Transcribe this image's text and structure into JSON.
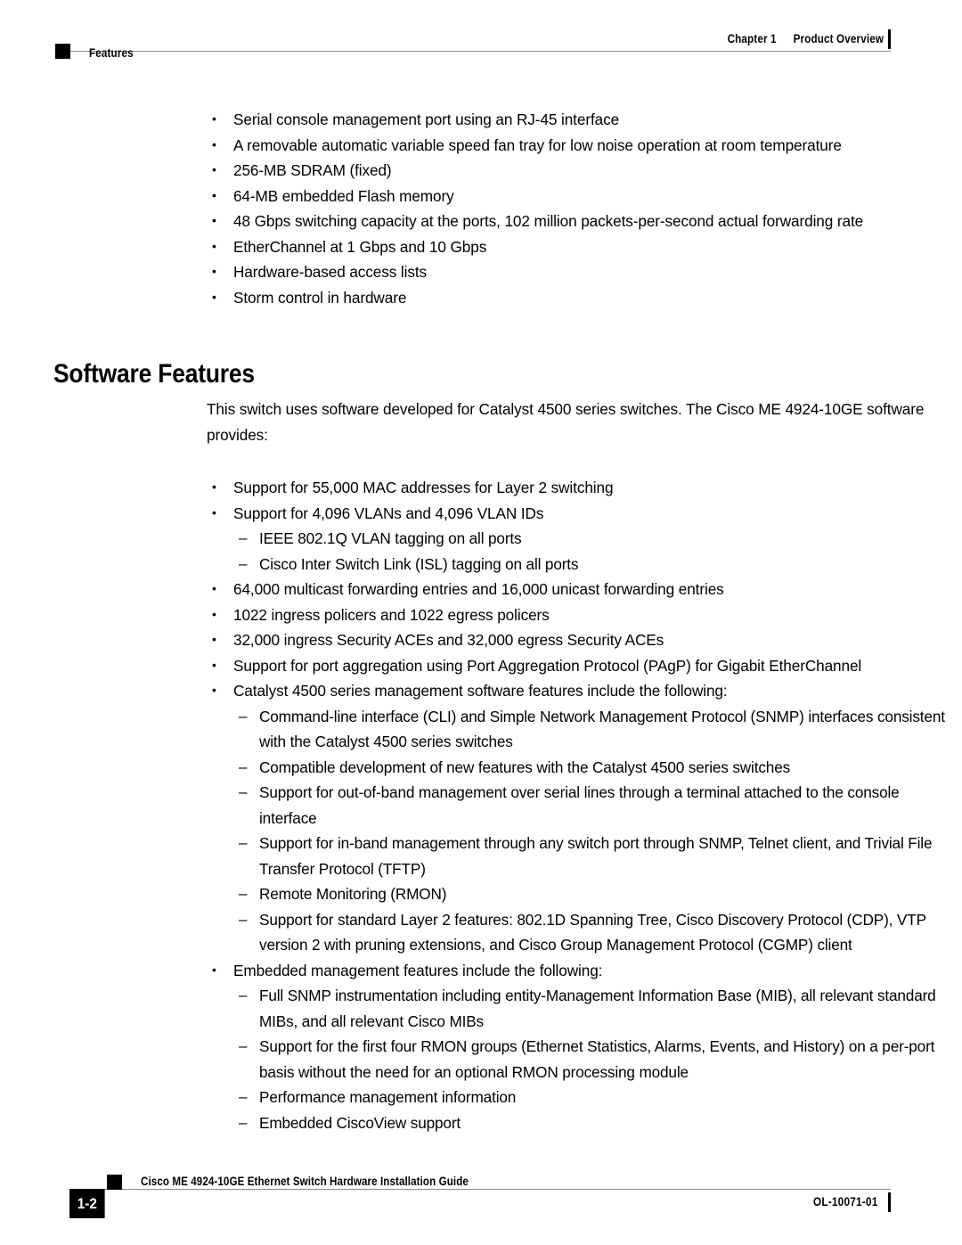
{
  "header": {
    "chapter": "Chapter 1",
    "chapter_title": "Product Overview",
    "section": "Features"
  },
  "hardware_bullets": [
    "Serial console management port using an RJ-45 interface",
    "A removable automatic variable speed fan tray for low noise operation at room temperature",
    "256-MB SDRAM (fixed)",
    "64-MB embedded Flash memory",
    "48 Gbps switching capacity at the ports, 102 million packets-per-second actual forwarding rate",
    "EtherChannel at 1 Gbps and 10 Gbps",
    "Hardware-based access lists",
    "Storm control in hardware"
  ],
  "software_section": {
    "heading": "Software Features",
    "intro": "This switch uses software developed for Catalyst 4500 series switches. The Cisco ME 4924-10GE software provides:",
    "items": [
      {
        "level": 1,
        "text": "Support for 55,000 MAC addresses for Layer 2 switching"
      },
      {
        "level": 1,
        "text": "Support for 4,096 VLANs and 4,096 VLAN IDs"
      },
      {
        "level": 2,
        "text": "IEEE 802.1Q VLAN tagging on all ports"
      },
      {
        "level": 2,
        "text": "Cisco Inter Switch Link (ISL) tagging on all ports"
      },
      {
        "level": 1,
        "text": "64,000 multicast forwarding entries and 16,000 unicast forwarding entries"
      },
      {
        "level": 1,
        "text": "1022 ingress policers and 1022 egress policers"
      },
      {
        "level": 1,
        "text": "32,000 ingress Security ACEs and 32,000 egress Security ACEs"
      },
      {
        "level": 1,
        "text": "Support for port aggregation using Port Aggregation Protocol (PAgP) for Gigabit EtherChannel"
      },
      {
        "level": 1,
        "text": "Catalyst 4500 series management software features include the following:"
      },
      {
        "level": 2,
        "text": "Command-line interface (CLI) and Simple Network Management Protocol (SNMP) interfaces consistent with the Catalyst 4500 series switches"
      },
      {
        "level": 2,
        "text": "Compatible development of new features with the Catalyst 4500 series switches"
      },
      {
        "level": 2,
        "text": "Support for out-of-band management over serial lines through a terminal attached to the console interface"
      },
      {
        "level": 2,
        "text": "Support for in-band management through any switch port through SNMP, Telnet client, and Trivial File Transfer Protocol (TFTP)"
      },
      {
        "level": 2,
        "text": "Remote Monitoring (RMON)"
      },
      {
        "level": 2,
        "text": "Support for standard Layer 2 features: 802.1D Spanning Tree, Cisco Discovery Protocol (CDP), VTP version 2 with pruning extensions, and Cisco Group Management Protocol (CGMP) client"
      },
      {
        "level": 1,
        "text": "Embedded management features include the following:"
      },
      {
        "level": 2,
        "text": "Full SNMP instrumentation including entity-Management Information Base (MIB), all relevant standard MIBs, and all relevant Cisco MIBs"
      },
      {
        "level": 2,
        "text": "Support for the first four RMON groups (Ethernet Statistics, Alarms, Events, and History) on a per-port basis without the need for an optional RMON processing module"
      },
      {
        "level": 2,
        "text": "Performance management information"
      },
      {
        "level": 2,
        "text": "Embedded CiscoView support"
      }
    ]
  },
  "footer": {
    "page_number": "1-2",
    "guide_title": "Cisco ME 4924-10GE Ethernet Switch Hardware Installation Guide",
    "doc_id": "OL-10071-01"
  }
}
